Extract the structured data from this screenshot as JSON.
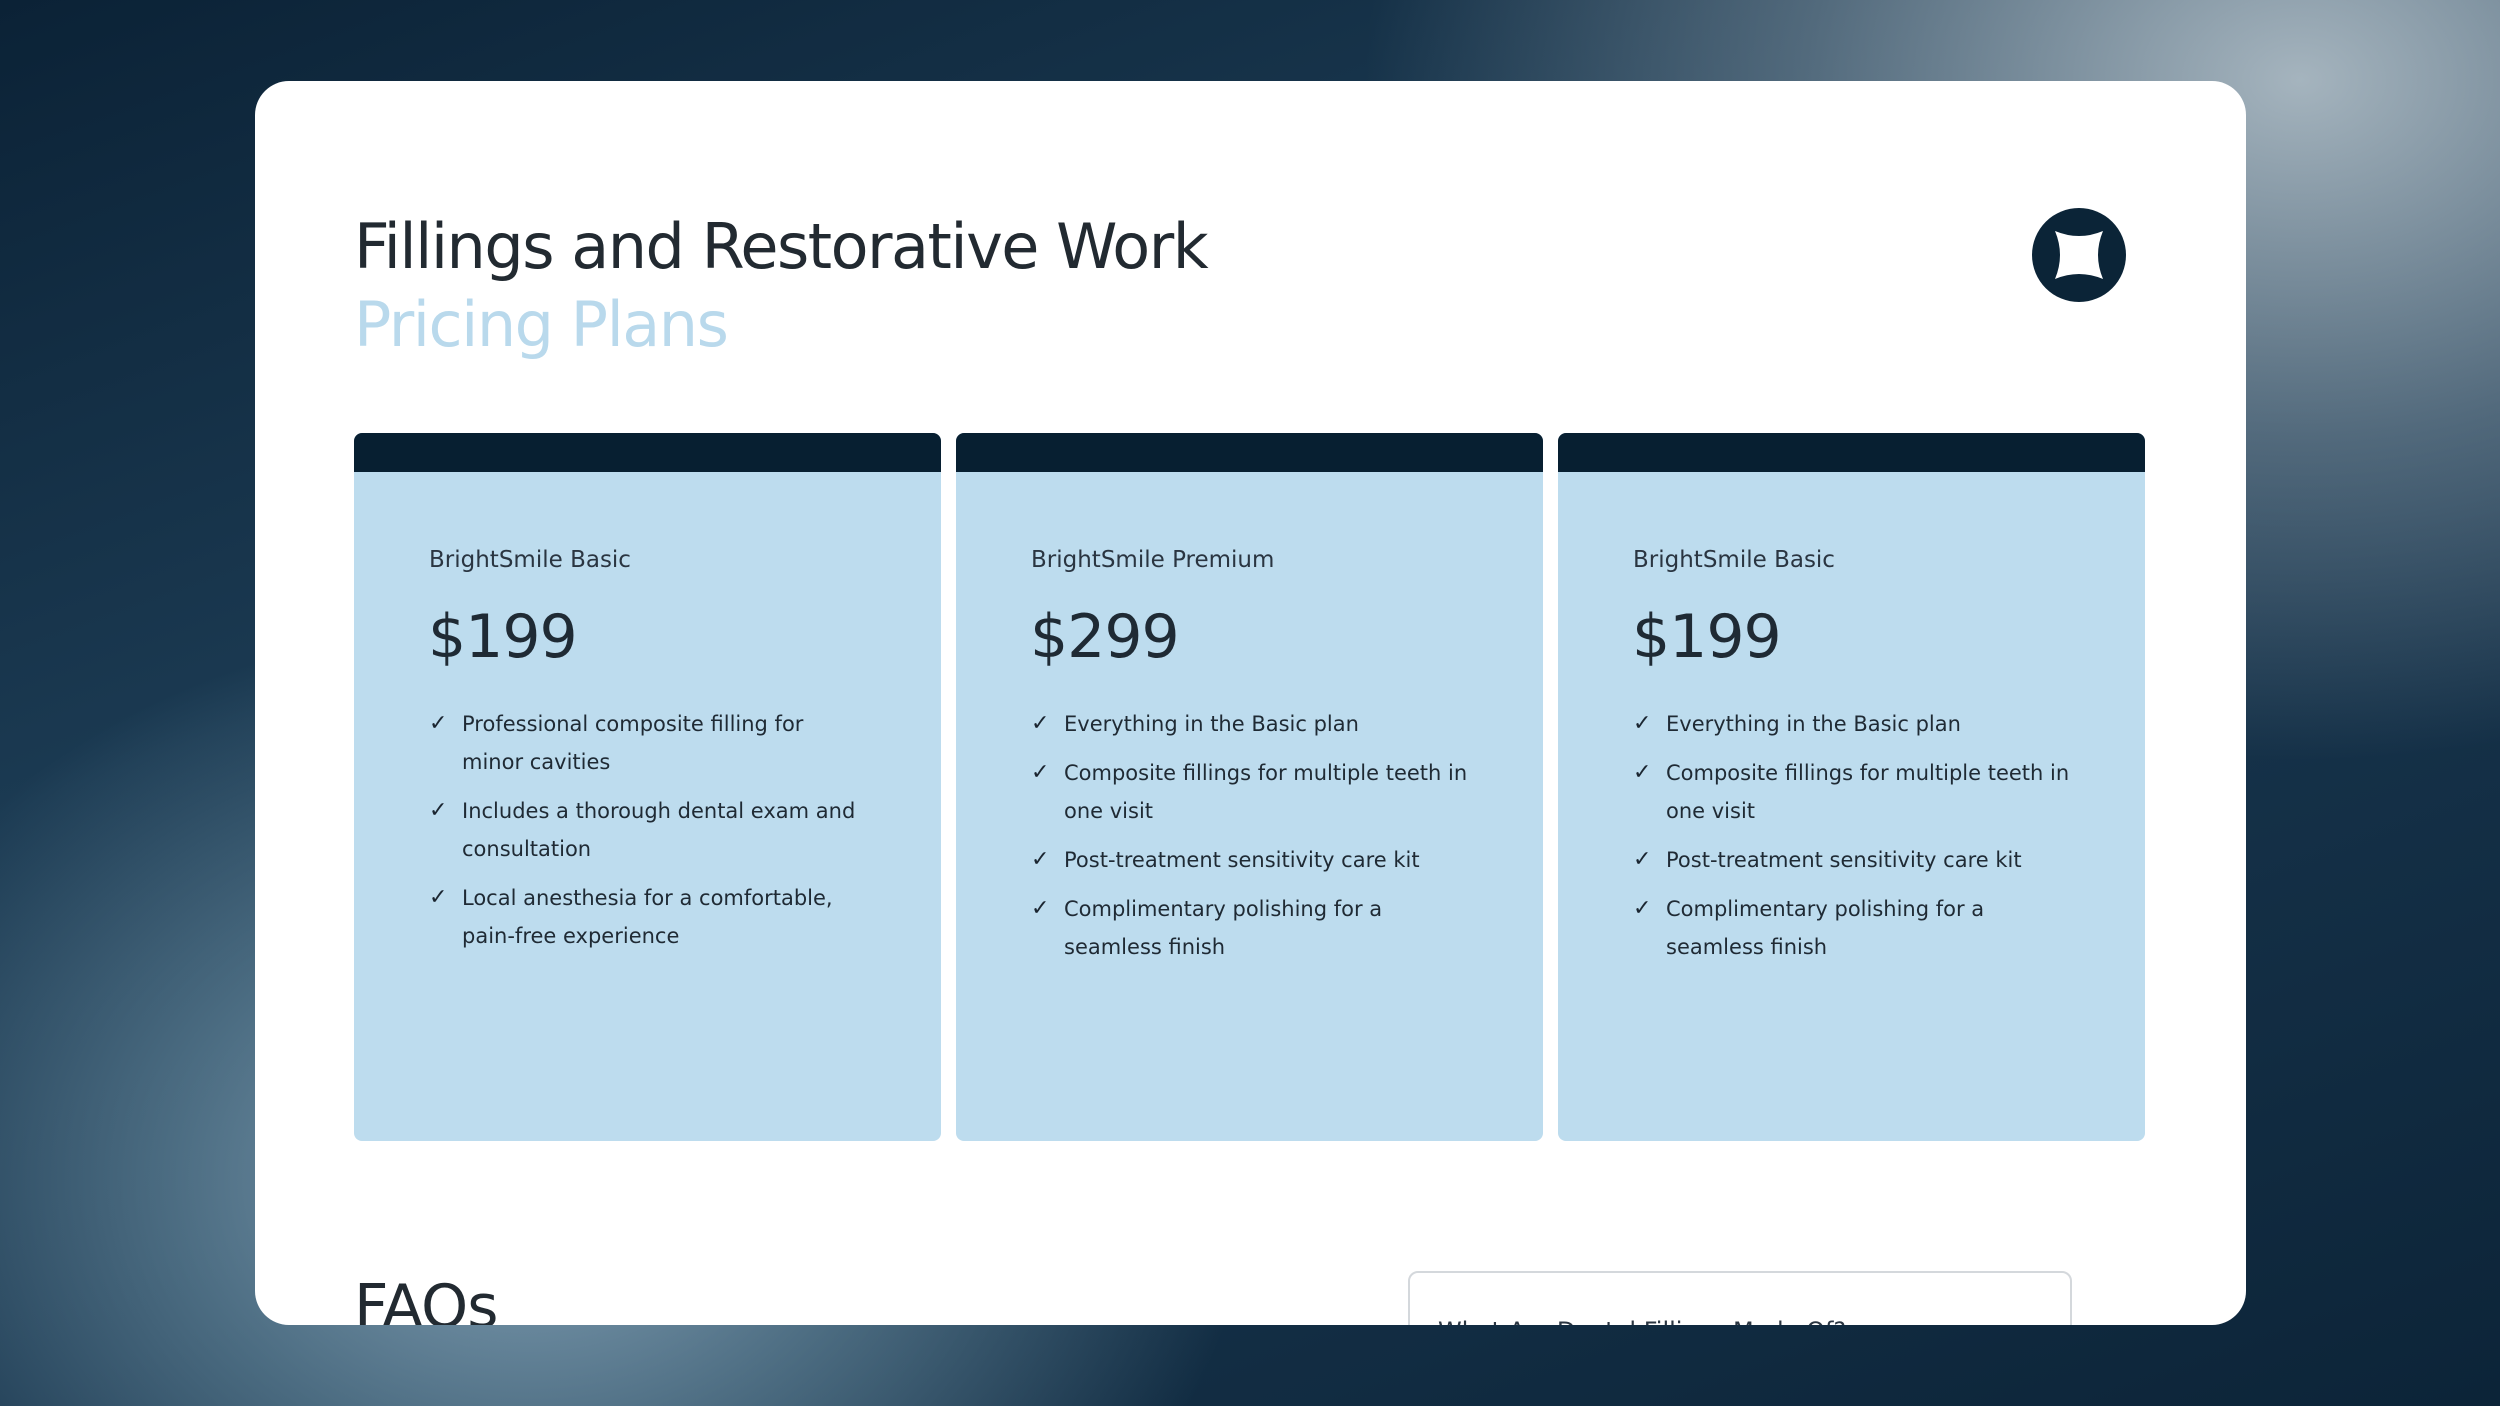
{
  "header": {
    "title": "Fillings and Restorative Work",
    "subtitle": "Pricing Plans"
  },
  "logo": {
    "icon": "rounded-square-emblem-icon",
    "color": "#0b2437"
  },
  "colors": {
    "card_background": "#bddcee",
    "card_header_bar": "#071f31",
    "subtitle": "#b9d9ec"
  },
  "plans": [
    {
      "name": "BrightSmile Basic",
      "price": "$199",
      "features": [
        "Professional composite filling for minor cavities",
        "Includes a thorough dental exam and consultation",
        "Local anesthesia for a comfortable, pain-free experience"
      ]
    },
    {
      "name": "BrightSmile Premium",
      "price": "$299",
      "features": [
        "Everything in the Basic plan",
        "Composite fillings for multiple teeth in one visit",
        "Post-treatment sensitivity care kit",
        "Complimentary polishing for a seamless finish"
      ]
    },
    {
      "name": "BrightSmile Basic",
      "price": "$199",
      "features": [
        "Everything in the Basic plan",
        "Composite fillings for multiple teeth in one visit",
        "Post-treatment sensitivity care kit",
        "Complimentary polishing for a seamless finish"
      ]
    }
  ],
  "check_glyph": "✓",
  "faq": {
    "title": "FAQs",
    "first_question": "What Are Dental Fillings Made Of?"
  }
}
